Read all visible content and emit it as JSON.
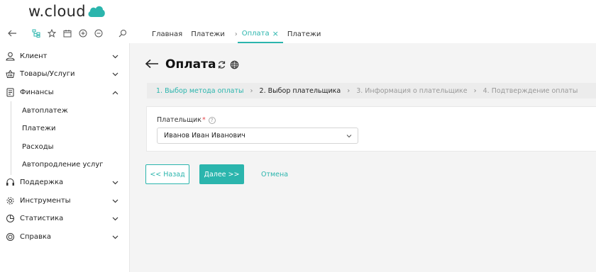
{
  "brand": {
    "logo_text": "w.cloud",
    "accent": "#2bb5ad"
  },
  "toolbar": {
    "icons": [
      "back-icon",
      "hierarchy-icon",
      "star-icon",
      "calendar-icon",
      "plus-circle-icon",
      "minus-circle-icon",
      "search-icon"
    ]
  },
  "tabs": [
    {
      "label": "Главная"
    },
    {
      "label": "Платежи"
    },
    {
      "label": "Оплата",
      "active": true,
      "close": "×"
    },
    {
      "label": "Платежи"
    }
  ],
  "tab_separator": "›",
  "sidebar": {
    "items": [
      {
        "label": "Клиент",
        "icon": "user-icon"
      },
      {
        "label": "Товары/Услуги",
        "icon": "basket-icon"
      },
      {
        "label": "Финансы",
        "icon": "wallet-icon",
        "expanded": true
      },
      {
        "label": "Поддержка",
        "icon": "headset-icon"
      },
      {
        "label": "Инструменты",
        "icon": "gear-icon"
      },
      {
        "label": "Статистика",
        "icon": "pie-chart-icon"
      },
      {
        "label": "Справка",
        "icon": "lifebuoy-icon"
      }
    ],
    "sub_items": [
      "Автоплатеж",
      "Платежи",
      "Расходы",
      "Автопродление услуг"
    ]
  },
  "page": {
    "title": "Оплата",
    "steps": [
      "1. Выбор метода оплаты",
      "2. Выбор плательщика",
      "3. Информация о плательщике",
      "4. Подтверждение оплаты"
    ],
    "step_arrow": "›",
    "payer_label": "Плательщик",
    "required_mark": "*",
    "help_mark": "?",
    "payer_value": "Иванов Иван Иванович"
  },
  "buttons": {
    "back": "<< Назад",
    "next": "Далее >>",
    "cancel": "Отмена"
  }
}
